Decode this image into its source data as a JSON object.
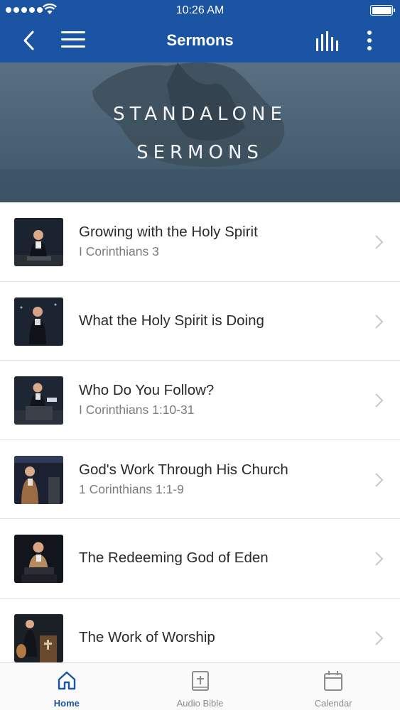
{
  "status_bar": {
    "time": "10:26 AM"
  },
  "header": {
    "title": "Sermons",
    "back_icon": "chevron-left-icon",
    "menu_icon": "hamburger-icon",
    "audio_icon": "equalizer-icon",
    "more_icon": "more-vertical-icon",
    "color": "#1c54a4"
  },
  "banner": {
    "line1": "STANDALONE",
    "line2": "SERMONS"
  },
  "sermons": [
    {
      "title": "Growing with the Holy Spirit",
      "reference": "I Corinthians 3"
    },
    {
      "title": "What the Holy Spirit is Doing",
      "reference": ""
    },
    {
      "title": "Who Do You Follow?",
      "reference": "I Corinthians 1:10-31"
    },
    {
      "title": "God's Work Through His Church",
      "reference": "1 Corinthians 1:1-9"
    },
    {
      "title": "The Redeeming God of Eden",
      "reference": ""
    },
    {
      "title": "The Work of Worship",
      "reference": ""
    }
  ],
  "tabs": [
    {
      "label": "Home",
      "icon": "home-icon",
      "active": true
    },
    {
      "label": "Audio Bible",
      "icon": "bible-icon",
      "active": false
    },
    {
      "label": "Calendar",
      "icon": "calendar-icon",
      "active": false
    }
  ],
  "colors": {
    "accent": "#1c54a4",
    "inactive_tab": "#8b8b8b"
  }
}
